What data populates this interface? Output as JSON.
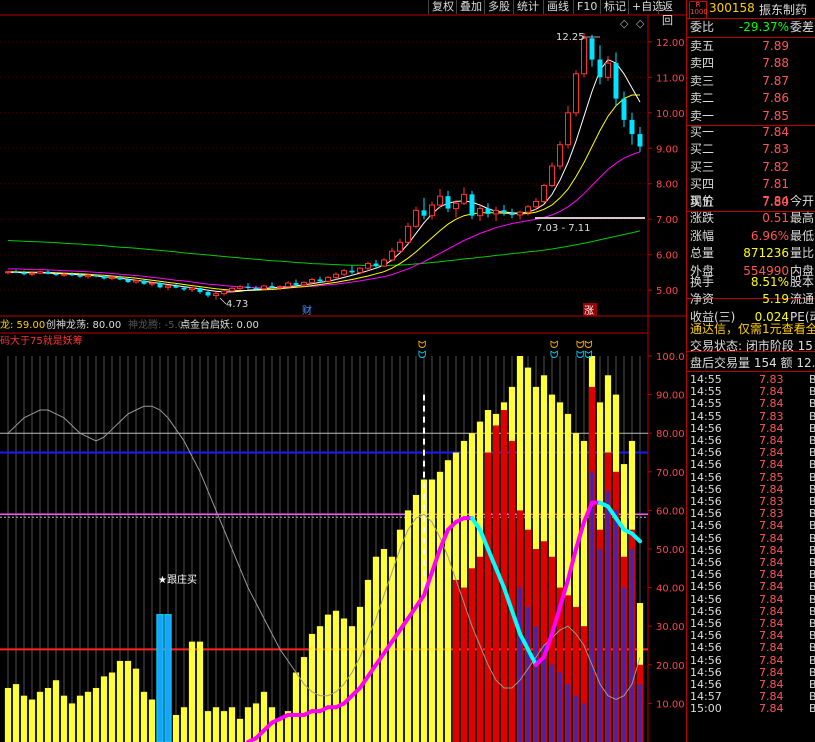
{
  "toolbar": {
    "buttons": [
      "复权",
      "叠加",
      "多股",
      "统计",
      "画线",
      "F10",
      "标记",
      "+自选",
      "返回"
    ]
  },
  "stock": {
    "logo": "R\n1000",
    "code": "300158",
    "name": "振东制药"
  },
  "main_chart": {
    "price_axis": [
      "12.00",
      "11.00",
      "10.00",
      "9.00",
      "8.00",
      "7.00",
      "6.00",
      "5.00"
    ],
    "high_label": "12.25",
    "low_label": "4.73",
    "range_label": "7.03 - 7.11",
    "markers": [
      "财",
      "涨"
    ],
    "colors": {
      "up": "#ff3333",
      "down": "#00e5ff",
      "ma5": "#ffffff",
      "ma10": "#ffff00",
      "ma20": "#ff00ff",
      "ma60": "#00cc00"
    }
  },
  "indicator": {
    "legend_1": "龙: 59.00",
    "legend_2": "创神龙荡: 80.00",
    "legend_3": "神龙腾: -5.00",
    "legend_4": "点金台启妖: 0.00",
    "note": "码大于75就是妖筹",
    "signal_label": "★跟庄买",
    "axis": [
      "100.0",
      "90.00",
      "80.00",
      "70.00",
      "60.00",
      "50.00",
      "40.00",
      "30.00",
      "20.00",
      "10.00"
    ]
  },
  "chart_data": {
    "type": "candlestick",
    "price_ylim": [
      4.3,
      12.7
    ],
    "indicator_ylim": [
      0,
      100
    ],
    "ref_lines": [
      75,
      59,
      24
    ],
    "white_ref": 80,
    "candles": [
      [
        5.5,
        5.55,
        5.45,
        5.52
      ],
      [
        5.52,
        5.58,
        5.48,
        5.5
      ],
      [
        5.5,
        5.55,
        5.42,
        5.45
      ],
      [
        5.45,
        5.52,
        5.4,
        5.48
      ],
      [
        5.48,
        5.55,
        5.45,
        5.52
      ],
      [
        5.52,
        5.56,
        5.44,
        5.46
      ],
      [
        5.46,
        5.5,
        5.4,
        5.43
      ],
      [
        5.43,
        5.48,
        5.38,
        5.45
      ],
      [
        5.45,
        5.5,
        5.4,
        5.42
      ],
      [
        5.42,
        5.47,
        5.35,
        5.38
      ],
      [
        5.38,
        5.45,
        5.33,
        5.42
      ],
      [
        5.42,
        5.46,
        5.36,
        5.39
      ],
      [
        5.39,
        5.43,
        5.3,
        5.33
      ],
      [
        5.33,
        5.4,
        5.28,
        5.36
      ],
      [
        5.36,
        5.41,
        5.28,
        5.3
      ],
      [
        5.3,
        5.34,
        5.2,
        5.23
      ],
      [
        5.23,
        5.3,
        5.18,
        5.27
      ],
      [
        5.27,
        5.31,
        5.15,
        5.18
      ],
      [
        5.18,
        5.24,
        5.1,
        5.2
      ],
      [
        5.2,
        5.25,
        5.05,
        5.08
      ],
      [
        5.08,
        5.15,
        5.0,
        5.12
      ],
      [
        5.12,
        5.18,
        5.05,
        5.07
      ],
      [
        5.07,
        5.12,
        4.98,
        5.02
      ],
      [
        5.02,
        5.1,
        4.95,
        5.06
      ],
      [
        5.06,
        5.1,
        4.9,
        4.95
      ],
      [
        4.95,
        5.02,
        4.8,
        4.85
      ],
      [
        4.85,
        4.95,
        4.73,
        4.9
      ],
      [
        4.9,
        5.0,
        4.85,
        4.98
      ],
      [
        4.98,
        5.1,
        4.92,
        5.05
      ],
      [
        5.05,
        5.15,
        5.0,
        5.1
      ],
      [
        5.1,
        5.2,
        5.02,
        5.06
      ],
      [
        5.06,
        5.12,
        4.98,
        5.04
      ],
      [
        5.04,
        5.15,
        5.0,
        5.12
      ],
      [
        5.12,
        5.22,
        5.05,
        5.08
      ],
      [
        5.08,
        5.14,
        5.0,
        5.1
      ],
      [
        5.1,
        5.25,
        5.08,
        5.2
      ],
      [
        5.2,
        5.3,
        5.12,
        5.15
      ],
      [
        5.15,
        5.25,
        5.1,
        5.22
      ],
      [
        5.22,
        5.35,
        5.18,
        5.3
      ],
      [
        5.3,
        5.38,
        5.2,
        5.25
      ],
      [
        5.25,
        5.4,
        5.22,
        5.36
      ],
      [
        5.36,
        5.5,
        5.3,
        5.45
      ],
      [
        5.45,
        5.6,
        5.4,
        5.55
      ],
      [
        5.55,
        5.7,
        5.45,
        5.5
      ],
      [
        5.5,
        5.65,
        5.45,
        5.62
      ],
      [
        5.62,
        5.8,
        5.55,
        5.75
      ],
      [
        5.75,
        5.85,
        5.6,
        5.68
      ],
      [
        5.68,
        5.9,
        5.65,
        5.85
      ],
      [
        5.85,
        6.2,
        5.8,
        6.1
      ],
      [
        6.1,
        6.45,
        6.05,
        6.35
      ],
      [
        6.35,
        6.9,
        6.3,
        6.8
      ],
      [
        6.8,
        7.35,
        6.75,
        7.25
      ],
      [
        7.25,
        7.6,
        7.0,
        7.1
      ],
      [
        7.1,
        7.5,
        7.0,
        7.4
      ],
      [
        7.4,
        7.85,
        7.3,
        7.65
      ],
      [
        7.65,
        7.8,
        7.2,
        7.3
      ],
      [
        7.3,
        7.55,
        7.05,
        7.45
      ],
      [
        7.45,
        7.9,
        7.4,
        7.7
      ],
      [
        7.7,
        7.8,
        7.0,
        7.1
      ],
      [
        7.1,
        7.4,
        6.95,
        7.3
      ],
      [
        7.3,
        7.45,
        7.05,
        7.15
      ],
      [
        7.15,
        7.35,
        6.95,
        7.25
      ],
      [
        7.25,
        7.4,
        7.1,
        7.18
      ],
      [
        7.18,
        7.3,
        7.03,
        7.12
      ],
      [
        7.12,
        7.25,
        7.0,
        7.2
      ],
      [
        7.2,
        7.4,
        7.1,
        7.35
      ],
      [
        7.35,
        7.6,
        7.25,
        7.5
      ],
      [
        7.5,
        8.0,
        7.45,
        7.95
      ],
      [
        7.95,
        8.6,
        7.9,
        8.5
      ],
      [
        8.5,
        9.2,
        8.4,
        9.1
      ],
      [
        9.1,
        10.2,
        9.0,
        10.0
      ],
      [
        10.0,
        11.2,
        9.9,
        11.1
      ],
      [
        11.1,
        12.25,
        11.0,
        12.1
      ],
      [
        12.1,
        12.2,
        11.3,
        11.5
      ],
      [
        11.5,
        11.9,
        10.8,
        11.0
      ],
      [
        11.0,
        11.6,
        10.9,
        11.4
      ],
      [
        11.4,
        11.7,
        10.2,
        10.4
      ],
      [
        10.4,
        10.6,
        9.6,
        9.8
      ],
      [
        9.8,
        10.0,
        9.1,
        9.4
      ],
      [
        9.4,
        9.6,
        8.9,
        9.05
      ]
    ],
    "ma5": [
      5.5,
      5.5,
      5.49,
      5.49,
      5.49,
      5.48,
      5.47,
      5.46,
      5.45,
      5.43,
      5.42,
      5.4,
      5.38,
      5.36,
      5.34,
      5.31,
      5.28,
      5.25,
      5.22,
      5.19,
      5.16,
      5.13,
      5.1,
      5.07,
      5.04,
      5.0,
      4.97,
      4.95,
      4.95,
      4.97,
      5.0,
      5.02,
      5.04,
      5.06,
      5.08,
      5.1,
      5.12,
      5.15,
      5.18,
      5.22,
      5.25,
      5.3,
      5.36,
      5.42,
      5.48,
      5.55,
      5.62,
      5.7,
      5.85,
      6.05,
      6.3,
      6.6,
      6.9,
      7.15,
      7.35,
      7.45,
      7.5,
      7.52,
      7.48,
      7.4,
      7.3,
      7.22,
      7.2,
      7.18,
      7.17,
      7.2,
      7.28,
      7.42,
      7.7,
      8.1,
      8.6,
      9.2,
      9.9,
      10.6,
      11.2,
      11.5,
      11.4,
      11.1,
      10.7,
      10.3
    ],
    "ma10": [
      5.52,
      5.52,
      5.51,
      5.51,
      5.5,
      5.5,
      5.49,
      5.48,
      5.47,
      5.46,
      5.45,
      5.43,
      5.42,
      5.4,
      5.38,
      5.36,
      5.34,
      5.31,
      5.28,
      5.25,
      5.22,
      5.19,
      5.16,
      5.13,
      5.1,
      5.07,
      5.04,
      5.02,
      5.0,
      4.99,
      4.99,
      5.0,
      5.01,
      5.02,
      5.04,
      5.06,
      5.08,
      5.1,
      5.13,
      5.16,
      5.19,
      5.22,
      5.26,
      5.3,
      5.35,
      5.4,
      5.46,
      5.52,
      5.62,
      5.75,
      5.9,
      6.08,
      6.28,
      6.48,
      6.68,
      6.86,
      7.0,
      7.1,
      7.15,
      7.18,
      7.18,
      7.18,
      7.17,
      7.16,
      7.15,
      7.16,
      7.2,
      7.28,
      7.4,
      7.6,
      7.85,
      8.2,
      8.6,
      9.05,
      9.5,
      9.9,
      10.2,
      10.4,
      10.5,
      10.5
    ],
    "ma20": [
      5.6,
      5.6,
      5.59,
      5.58,
      5.58,
      5.57,
      5.56,
      5.55,
      5.54,
      5.53,
      5.52,
      5.5,
      5.49,
      5.47,
      5.45,
      5.43,
      5.41,
      5.39,
      5.36,
      5.34,
      5.31,
      5.28,
      5.26,
      5.23,
      5.2,
      5.17,
      5.15,
      5.13,
      5.11,
      5.09,
      5.08,
      5.07,
      5.07,
      5.07,
      5.07,
      5.08,
      5.09,
      5.1,
      5.11,
      5.13,
      5.15,
      5.17,
      5.2,
      5.23,
      5.26,
      5.3,
      5.34,
      5.38,
      5.44,
      5.52,
      5.6,
      5.7,
      5.8,
      5.92,
      6.04,
      6.16,
      6.28,
      6.4,
      6.5,
      6.6,
      6.68,
      6.76,
      6.82,
      6.88,
      6.92,
      6.96,
      7.0,
      7.05,
      7.12,
      7.22,
      7.35,
      7.52,
      7.72,
      7.95,
      8.18,
      8.4,
      8.58,
      8.72,
      8.82,
      8.9
    ],
    "ma60": [
      6.4,
      6.39,
      6.38,
      6.37,
      6.36,
      6.35,
      6.34,
      6.32,
      6.31,
      6.3,
      6.28,
      6.27,
      6.25,
      6.23,
      6.21,
      6.2,
      6.18,
      6.16,
      6.14,
      6.12,
      6.1,
      6.08,
      6.05,
      6.03,
      6.01,
      5.99,
      5.97,
      5.95,
      5.93,
      5.91,
      5.89,
      5.87,
      5.85,
      5.83,
      5.82,
      5.8,
      5.78,
      5.77,
      5.75,
      5.74,
      5.73,
      5.72,
      5.71,
      5.7,
      5.7,
      5.69,
      5.69,
      5.69,
      5.7,
      5.71,
      5.72,
      5.74,
      5.76,
      5.78,
      5.8,
      5.83,
      5.85,
      5.88,
      5.9,
      5.93,
      5.95,
      5.98,
      6.0,
      6.03,
      6.05,
      6.08,
      6.1,
      6.13,
      6.16,
      6.2,
      6.24,
      6.28,
      6.32,
      6.37,
      6.42,
      6.47,
      6.52,
      6.57,
      6.62,
      6.67
    ],
    "bars_yellow": [
      14,
      15,
      12,
      11,
      13,
      14,
      16,
      12,
      10,
      12,
      13,
      14,
      17,
      18,
      21,
      21,
      19,
      13,
      11,
      9,
      8,
      7,
      9,
      26,
      26,
      8,
      9,
      8,
      9,
      6,
      9,
      10,
      13,
      9,
      6,
      8,
      18,
      22,
      28,
      30,
      33,
      34,
      32,
      30,
      35,
      42,
      48,
      50,
      48,
      55,
      60,
      64,
      68,
      68,
      70,
      73,
      75,
      78,
      80,
      83,
      86,
      85,
      88,
      92,
      100,
      97,
      92,
      95,
      90,
      88,
      85,
      80,
      78,
      100,
      88,
      95,
      90,
      72,
      78,
      36
    ],
    "bars_red": [
      0,
      0,
      0,
      0,
      0,
      0,
      0,
      0,
      0,
      0,
      0,
      0,
      0,
      0,
      0,
      0,
      0,
      0,
      0,
      0,
      0,
      0,
      0,
      0,
      0,
      0,
      0,
      0,
      0,
      0,
      0,
      0,
      0,
      0,
      0,
      0,
      0,
      0,
      0,
      0,
      0,
      0,
      0,
      0,
      0,
      0,
      0,
      0,
      0,
      0,
      0,
      0,
      0,
      0,
      0,
      0,
      42,
      40,
      45,
      48,
      75,
      82,
      86,
      78,
      60,
      55,
      50,
      52,
      48,
      40,
      38,
      35,
      30,
      92,
      55,
      75,
      70,
      48,
      55,
      20
    ],
    "bars_blue": [
      0,
      0,
      0,
      0,
      0,
      0,
      0,
      0,
      0,
      0,
      0,
      0,
      0,
      0,
      0,
      0,
      0,
      0,
      0,
      0,
      0,
      0,
      0,
      0,
      0,
      0,
      0,
      0,
      0,
      0,
      0,
      0,
      0,
      0,
      0,
      0,
      0,
      0,
      0,
      0,
      0,
      0,
      0,
      0,
      0,
      0,
      0,
      0,
      0,
      0,
      0,
      0,
      0,
      0,
      0,
      0,
      0,
      0,
      0,
      0,
      0,
      0,
      0,
      0,
      40,
      35,
      30,
      25,
      20,
      18,
      15,
      12,
      10,
      70,
      50,
      65,
      60,
      40,
      50,
      15
    ],
    "magenta": [
      0,
      0,
      0,
      0,
      0,
      0,
      0,
      0,
      0,
      0,
      0,
      0,
      0,
      0,
      0,
      0,
      0,
      0,
      0,
      0,
      0,
      0,
      0,
      0,
      0,
      0,
      0,
      0,
      0,
      0,
      0,
      1,
      3,
      5,
      6,
      7,
      7,
      7,
      8,
      8,
      9,
      9,
      10,
      12,
      14,
      17,
      20,
      23,
      26,
      29,
      32,
      35,
      38,
      44,
      50,
      55,
      57,
      58,
      58,
      55,
      50,
      45,
      40,
      34,
      28,
      24,
      20,
      22,
      28,
      35,
      42,
      50,
      57,
      62,
      62,
      61,
      58,
      55,
      54,
      52
    ],
    "white_curve": [
      80,
      82,
      84,
      85,
      86,
      86,
      85,
      84,
      82,
      80,
      79,
      78,
      79,
      81,
      83,
      85,
      86,
      87,
      87,
      86,
      84,
      81,
      78,
      74,
      70,
      65,
      60,
      55,
      50,
      45,
      40,
      36,
      32,
      28,
      24,
      21,
      18,
      15,
      13,
      12,
      12,
      13,
      15,
      18,
      22,
      27,
      32,
      38,
      44,
      50,
      55,
      58,
      59,
      57,
      53,
      48,
      42,
      36,
      30,
      25,
      20,
      16,
      14,
      14,
      16,
      19,
      22,
      25,
      27,
      29,
      30,
      28,
      25,
      20,
      15,
      12,
      11,
      12,
      15,
      22
    ]
  },
  "quote": {
    "weibi_label": "委比",
    "weibi_value": "-29.37%",
    "weicha_label": "委差",
    "sell": [
      {
        "label": "卖五",
        "price": "7.89"
      },
      {
        "label": "卖四",
        "price": "7.88"
      },
      {
        "label": "卖三",
        "price": "7.87"
      },
      {
        "label": "卖二",
        "price": "7.86"
      },
      {
        "label": "卖一",
        "price": "7.85"
      }
    ],
    "buy": [
      {
        "label": "买一",
        "price": "7.84"
      },
      {
        "label": "买二",
        "price": "7.83"
      },
      {
        "label": "买三",
        "price": "7.82"
      },
      {
        "label": "买四",
        "price": "7.81"
      },
      {
        "label": "买五",
        "price": "7.80"
      }
    ],
    "stats": [
      {
        "label": "现价",
        "value": "7.84",
        "color": "#ff5555",
        "label2": "今开"
      },
      {
        "label": "涨跌",
        "value": "0.51",
        "color": "#ff5555",
        "label2": "最高"
      },
      {
        "label": "涨幅",
        "value": "6.96%",
        "color": "#ff5555",
        "label2": "最低"
      },
      {
        "label": "总量",
        "value": "871236",
        "color": "#ffff00",
        "label2": "量比"
      },
      {
        "label": "外盘",
        "value": "554990",
        "color": "#ff5555",
        "label2": "内盘"
      }
    ],
    "stats2": [
      {
        "label": "换手",
        "value": "8.51%",
        "color": "#ffff00",
        "label2": "股本"
      },
      {
        "label": "净资",
        "value": "5.19",
        "color": "#ffff00",
        "label2": "流通"
      },
      {
        "label": "收益(三)",
        "value": "0.024",
        "color": "#ffff00",
        "label2": "PE(动)"
      }
    ],
    "ad": "通达信，仅需1元查看全",
    "status": "交易状态: 闭市阶段 15",
    "after": "盘后交易量 154 额 12.",
    "ticks": [
      {
        "t": "14:55",
        "p": "7.83"
      },
      {
        "t": "14:55",
        "p": "7.84"
      },
      {
        "t": "14:55",
        "p": "7.84"
      },
      {
        "t": "14:55",
        "p": "7.83"
      },
      {
        "t": "14:56",
        "p": "7.84"
      },
      {
        "t": "14:56",
        "p": "7.84"
      },
      {
        "t": "14:56",
        "p": "7.84"
      },
      {
        "t": "14:56",
        "p": "7.84"
      },
      {
        "t": "14:56",
        "p": "7.85"
      },
      {
        "t": "14:56",
        "p": "7.84"
      },
      {
        "t": "14:56",
        "p": "7.83"
      },
      {
        "t": "14:56",
        "p": "7.83"
      },
      {
        "t": "14:56",
        "p": "7.84"
      },
      {
        "t": "14:56",
        "p": "7.84"
      },
      {
        "t": "14:56",
        "p": "7.84"
      },
      {
        "t": "14:56",
        "p": "7.84"
      },
      {
        "t": "14:56",
        "p": "7.84"
      },
      {
        "t": "14:56",
        "p": "7.84"
      },
      {
        "t": "14:56",
        "p": "7.84"
      },
      {
        "t": "14:56",
        "p": "7.84"
      },
      {
        "t": "14:56",
        "p": "7.84"
      },
      {
        "t": "14:56",
        "p": "7.84"
      },
      {
        "t": "14:56",
        "p": "7.84"
      },
      {
        "t": "14:56",
        "p": "7.84"
      },
      {
        "t": "14:56",
        "p": "7.84"
      },
      {
        "t": "14:56",
        "p": "7.84"
      },
      {
        "t": "14:57",
        "p": "7.84"
      },
      {
        "t": "15:00",
        "p": "7.84"
      }
    ],
    "tick_marker": "B"
  }
}
